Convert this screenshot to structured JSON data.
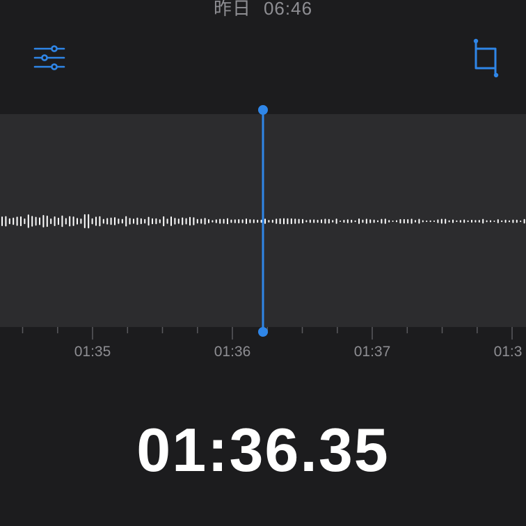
{
  "header": {
    "date_label": "昨日",
    "time_label": "06:46"
  },
  "toolbar": {
    "options_icon": "sliders-icon",
    "crop_icon": "crop-icon"
  },
  "timeline": {
    "tick_labels": [
      "01:35",
      "01:36",
      "01:37",
      "01:3"
    ]
  },
  "playback": {
    "current_time": "01:36.35"
  },
  "colors": {
    "accent": "#2f86e8",
    "background": "#1c1c1e",
    "wave_background": "#2c2c2e",
    "wave_bar": "#ffffff",
    "label": "#8e8e93"
  }
}
